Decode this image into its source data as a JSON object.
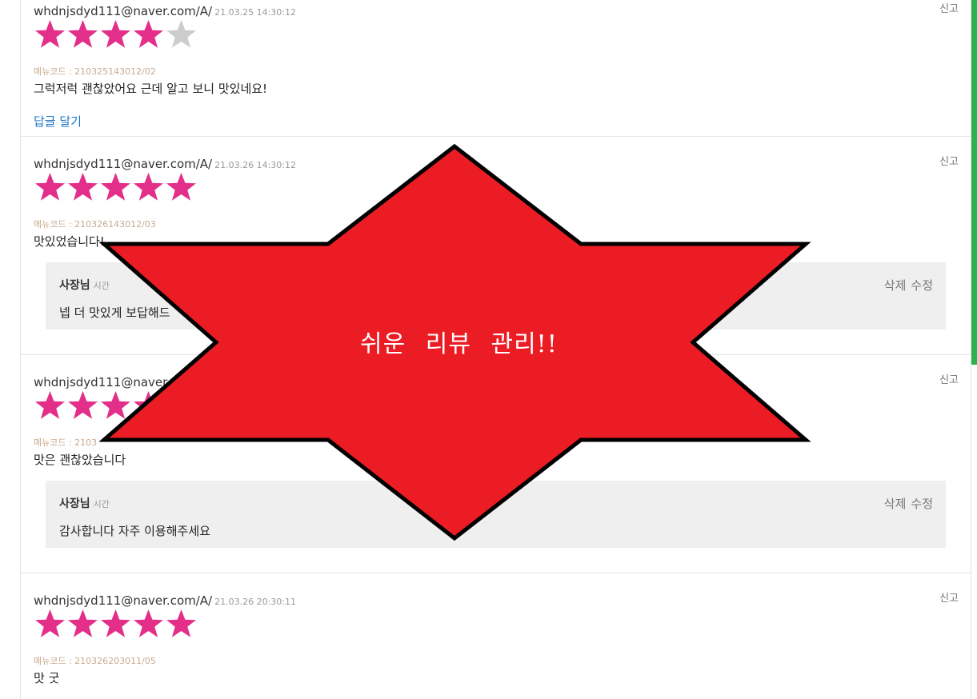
{
  "colors": {
    "star_filled": "#e32f8a",
    "star_empty": "#cccccc",
    "burst_fill": "#ec1c24",
    "accent_green": "#2bb24c",
    "link_blue": "#1a73c9"
  },
  "banner": {
    "text": "쉬운 리뷰 관리!!"
  },
  "reviews": [
    {
      "user": "whdnjsdyd111@naver.com/A/",
      "date": "21.03.25 14:30:12",
      "rating": 4,
      "menu_code": "메뉴코드 : 210325143012/02",
      "content": "그럭저럭 괜찮았어요 근데 알고 보니 맛있네요!",
      "report_label": "신고",
      "reply_link": "답글 달기"
    },
    {
      "user": "whdnjsdyd111@naver.com/A/",
      "date": "21.03.26 14:30:12",
      "rating": 5,
      "menu_code": "메뉴코드 : 210326143012/03",
      "content": "맛있었습니다!",
      "report_label": "신고",
      "owner_reply": {
        "name": "사장님",
        "time": "시간",
        "delete_label": "삭제",
        "edit_label": "수정",
        "text": "넵 더 맛있게 보답해드"
      }
    },
    {
      "user": "whdnjsdyd111@naver.c",
      "date": "",
      "rating": 5,
      "menu_code": "메뉴코드 : 2103",
      "content": "맛은 괜찮았습니다",
      "report_label": "신고",
      "owner_reply": {
        "name": "사장님",
        "time": "시간",
        "delete_label": "삭제",
        "edit_label": "수정",
        "text": "감사합니다 자주 이용해주세요"
      }
    },
    {
      "user": "whdnjsdyd111@naver.com/A/",
      "date": "21.03.26 20:30:11",
      "rating": 5,
      "menu_code": "메뉴코드 : 210326203011/05",
      "content": "맛 굿",
      "report_label": "신고"
    }
  ]
}
